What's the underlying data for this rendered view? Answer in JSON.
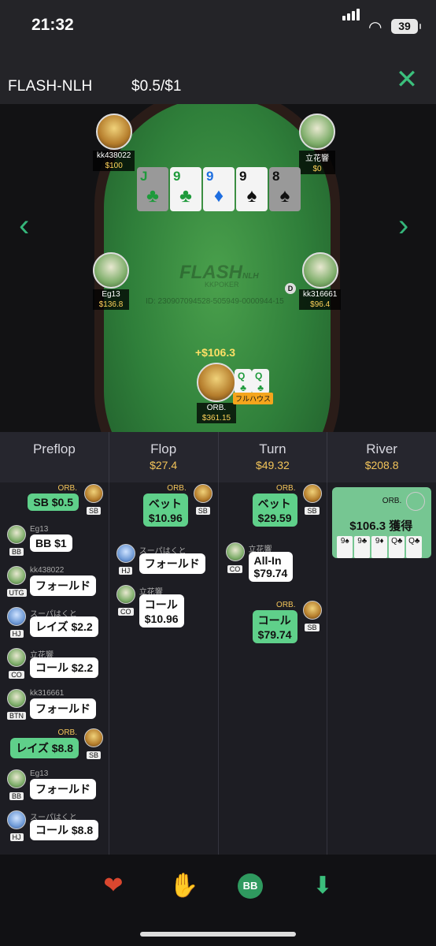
{
  "status_bar": {
    "time": "21:32",
    "battery": "39"
  },
  "header": {
    "game": "FLASH-NLH",
    "blinds": "$0.5/$1",
    "close_icon": "close-icon"
  },
  "table": {
    "logo": "FLASH",
    "logo_sub": "NLH",
    "logo_brand": "KKPOKER",
    "hand_id": "ID: 230907094528-505949-0000944-15",
    "dealer_button": "D",
    "win_amount": "+$106.3",
    "hand_label": "フルハウス",
    "players": [
      {
        "name": "kk438022",
        "stack": "$100"
      },
      {
        "name": "立花響",
        "stack": "$0"
      },
      {
        "name": "Eg13",
        "stack": "$136.8"
      },
      {
        "name": "kk316661",
        "stack": "$96.4"
      },
      {
        "name": "ORB.",
        "stack": "$361.15"
      }
    ],
    "board": [
      {
        "rank": "J",
        "suit": "♣"
      },
      {
        "rank": "9",
        "suit": "♣"
      },
      {
        "rank": "9",
        "suit": "♦"
      },
      {
        "rank": "9",
        "suit": "♠"
      },
      {
        "rank": "8",
        "suit": "♠"
      }
    ],
    "hero_cards": [
      {
        "rank": "Q",
        "suit": "♣"
      },
      {
        "rank": "Q",
        "suit": "♣"
      }
    ]
  },
  "streets": [
    {
      "name": "Preflop",
      "pot": ""
    },
    {
      "name": "Flop",
      "pot": "$27.4"
    },
    {
      "name": "Turn",
      "pot": "$49.32"
    },
    {
      "name": "River",
      "pot": "$208.8"
    }
  ],
  "preflop": [
    {
      "name": "ORB.",
      "pos": "SB",
      "action": "SB $0.5"
    },
    {
      "name": "Eg13",
      "pos": "BB",
      "action": "BB $1"
    },
    {
      "name": "kk438022",
      "pos": "UTG",
      "action": "フォールド"
    },
    {
      "name": "スーパはくと",
      "pos": "HJ",
      "action": "レイズ $2.2"
    },
    {
      "name": "立花響",
      "pos": "CO",
      "action": "コール $2.2"
    },
    {
      "name": "kk316661",
      "pos": "BTN",
      "action": "フォールド"
    },
    {
      "name": "ORB.",
      "pos": "SB",
      "action": "レイズ $8.8"
    },
    {
      "name": "Eg13",
      "pos": "BB",
      "action": "フォールド"
    },
    {
      "name": "スーパはくと",
      "pos": "HJ",
      "action": "コール $8.8"
    }
  ],
  "flop": [
    {
      "name": "ORB.",
      "pos": "SB",
      "action": "ベット",
      "amount": "$10.96"
    },
    {
      "name": "スーパはくと",
      "pos": "HJ",
      "action": "フォールド",
      "amount": ""
    },
    {
      "name": "立花響",
      "pos": "CO",
      "action": "コール",
      "amount": "$10.96"
    }
  ],
  "turn": [
    {
      "name": "ORB.",
      "pos": "SB",
      "action": "ベット",
      "amount": "$29.59"
    },
    {
      "name": "立花響",
      "pos": "CO",
      "action": "All-In",
      "amount": "$79.74"
    },
    {
      "name": "ORB.",
      "pos": "SB",
      "action": "コール",
      "amount": "$79.74"
    }
  ],
  "river": {
    "name": "ORB.",
    "result": "$106.3 獲得"
  },
  "river_cards": [
    "9♠",
    "9♣",
    "9♦",
    "Q♣",
    "Q♣"
  ],
  "toolbar": [
    "like-icon",
    "hand-icon",
    "bb-icon",
    "download-icon"
  ]
}
